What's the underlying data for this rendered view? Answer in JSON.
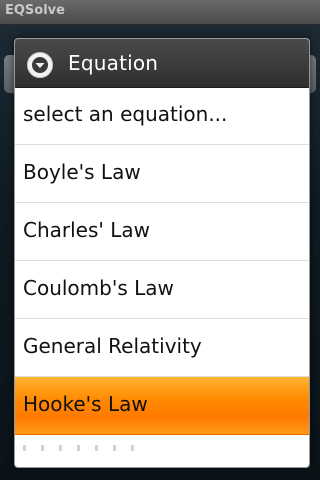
{
  "app": {
    "title": "EQSolve"
  },
  "dialog": {
    "title": "Equation",
    "icon": "dropdown-circle-icon",
    "items": [
      {
        "label": "select an equation..."
      },
      {
        "label": "Boyle's Law"
      },
      {
        "label": "Charles' Law"
      },
      {
        "label": "Coulomb's Law"
      },
      {
        "label": "General Relativity"
      },
      {
        "label": "Hooke's Law"
      }
    ],
    "selected_index": 5
  },
  "colors": {
    "selected_highlight": "#ff8a00",
    "header_bg": "#3a3a3a",
    "list_bg": "#ffffff"
  }
}
